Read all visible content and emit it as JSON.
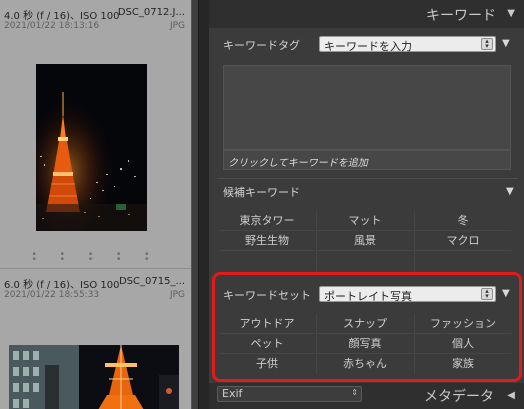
{
  "filmstrip": {
    "items": [
      {
        "exposure": "4.0 秒 (f / 16)、ISO 100",
        "filename": "DSC_0712.J...",
        "datetime": "2021/01/22 18:13:16",
        "format": "JPG"
      },
      {
        "exposure": "6.0 秒 (f / 16)、ISO 100",
        "filename": "DSC_0715_...",
        "datetime": "2021/01/22 18:55:33",
        "format": "JPG"
      }
    ],
    "dots": "• • • • •"
  },
  "keywording": {
    "title": "キーワード",
    "tag_label": "キーワードタグ",
    "tag_select": "キーワードを入力",
    "add_placeholder": "クリックしてキーワードを追加",
    "suggestions": {
      "label": "候補キーワード",
      "rows": [
        [
          "東京タワー",
          "マット",
          "冬"
        ],
        [
          "野生生物",
          "風景",
          "マクロ"
        ],
        [
          "",
          "",
          ""
        ]
      ]
    },
    "keyword_set": {
      "label": "キーワードセット",
      "selected": "ポートレイト写真",
      "rows": [
        [
          "アウトドア",
          "スナップ",
          "ファッション"
        ],
        [
          "ペット",
          "顔写真",
          "個人"
        ],
        [
          "子供",
          "赤ちゃん",
          "家族"
        ]
      ]
    }
  },
  "footer": {
    "preset": "Exif",
    "metadata_title": "メタデータ"
  },
  "colors": {
    "highlight": "#e11a1a",
    "panel_bg": "#3b3b3b",
    "filmstrip_bg": "#a7a7a7"
  },
  "icons": [
    "disclosure-triangle-icon",
    "dropdown-arrow-icon"
  ]
}
